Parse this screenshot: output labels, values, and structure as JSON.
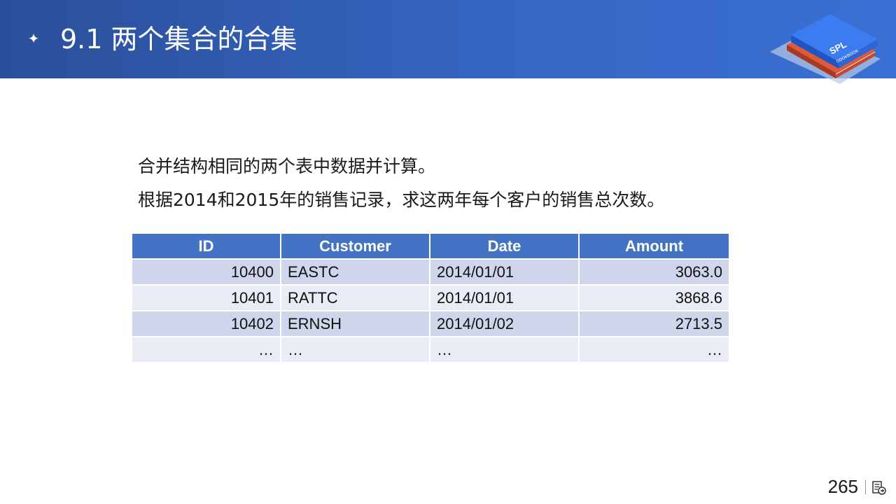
{
  "header": {
    "bullet_icon": "four-point-star-icon",
    "title": "9.1 两个集合的合集",
    "logo": {
      "text": "SPL",
      "subtext": "COOKBOOK"
    }
  },
  "content": {
    "line1": "合并结构相同的两个表中数据并计算。",
    "line2": "根据2014和2015年的销售记录，求这两年每个客户的销售总次数。"
  },
  "table": {
    "headers": [
      "ID",
      "Customer",
      "Date",
      "Amount"
    ],
    "rows": [
      [
        "10400",
        "EASTC",
        "2014/01/01",
        "3063.0"
      ],
      [
        "10401",
        "RATTC",
        "2014/01/01",
        "3868.6"
      ],
      [
        "10402",
        "ERNSH",
        "2014/01/02",
        "2713.5"
      ],
      [
        "…",
        "…",
        "…",
        "…"
      ]
    ]
  },
  "footer": {
    "page_number": "265",
    "nav_icon": "slide-navigation-icon"
  },
  "colors": {
    "header_start": "#2b4f9a",
    "header_end": "#3a70d4",
    "table_header": "#4472c4",
    "row_odd": "#cfd5ea",
    "row_even": "#e9ebf5"
  }
}
